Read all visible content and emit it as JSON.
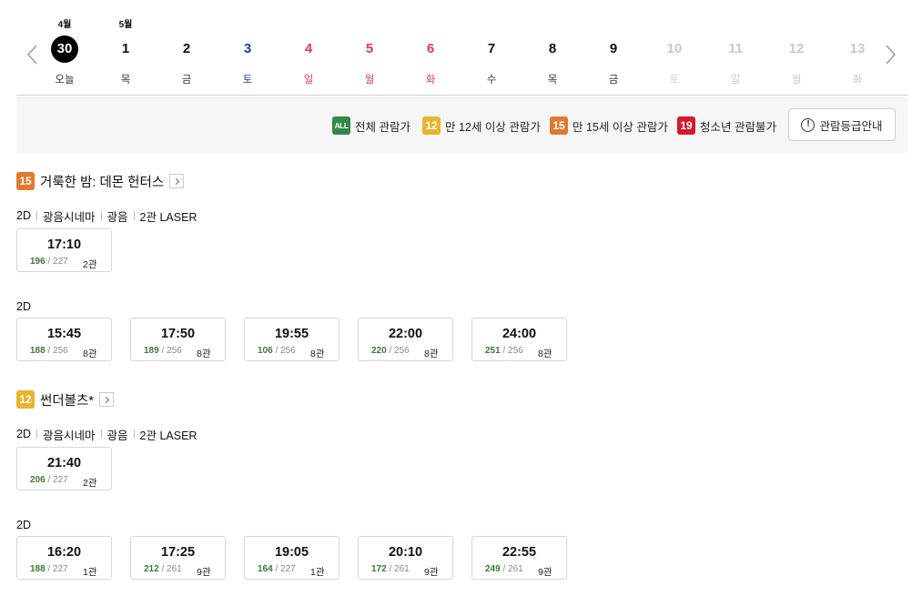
{
  "dates": [
    {
      "month": "4월",
      "day": "30",
      "dow": "오늘",
      "state": "today"
    },
    {
      "month": "5월",
      "day": "1",
      "dow": "목",
      "state": "normal"
    },
    {
      "month": "",
      "day": "2",
      "dow": "금",
      "state": "normal"
    },
    {
      "month": "",
      "day": "3",
      "dow": "토",
      "state": "sat"
    },
    {
      "month": "",
      "day": "4",
      "dow": "일",
      "state": "sun"
    },
    {
      "month": "",
      "day": "5",
      "dow": "월",
      "state": "sun"
    },
    {
      "month": "",
      "day": "6",
      "dow": "화",
      "state": "sun"
    },
    {
      "month": "",
      "day": "7",
      "dow": "수",
      "state": "normal"
    },
    {
      "month": "",
      "day": "8",
      "dow": "목",
      "state": "normal"
    },
    {
      "month": "",
      "day": "9",
      "dow": "금",
      "state": "normal"
    },
    {
      "month": "",
      "day": "10",
      "dow": "토",
      "state": "dis"
    },
    {
      "month": "",
      "day": "11",
      "dow": "일",
      "state": "dis"
    },
    {
      "month": "",
      "day": "12",
      "dow": "월",
      "state": "dis"
    },
    {
      "month": "",
      "day": "13",
      "dow": "화",
      "state": "dis"
    }
  ],
  "legend": {
    "all": {
      "badge": "ALL",
      "label": "전체 관람가"
    },
    "r12": {
      "badge": "12",
      "label": "만 12세 이상 관람가"
    },
    "r15": {
      "badge": "15",
      "label": "만 15세 이상 관람가"
    },
    "r19": {
      "badge": "19",
      "label": "청소년 관람불가"
    },
    "guide_label": "관람등급안내",
    "guide_icon": "!"
  },
  "movies": [
    {
      "rating": "15",
      "title": "거룩한 밤: 데몬 헌터스",
      "groups": [
        {
          "format": "2D",
          "tags": [
            "광음시네마",
            "광음",
            "2관 LASER"
          ],
          "slots": [
            {
              "time": "17:10",
              "remain": "196",
              "total": "/ 227",
              "hall": "2관"
            }
          ]
        },
        {
          "format": "2D",
          "tags": [],
          "slots": [
            {
              "time": "15:45",
              "remain": "188",
              "total": "/ 256",
              "hall": "8관"
            },
            {
              "time": "17:50",
              "remain": "189",
              "total": "/ 256",
              "hall": "8관"
            },
            {
              "time": "19:55",
              "remain": "106",
              "total": "/ 256",
              "hall": "8관"
            },
            {
              "time": "22:00",
              "remain": "220",
              "total": "/ 256",
              "hall": "8관"
            },
            {
              "time": "24:00",
              "remain": "251",
              "total": "/ 256",
              "hall": "8관"
            }
          ]
        }
      ]
    },
    {
      "rating": "12",
      "title": "썬더볼츠*",
      "groups": [
        {
          "format": "2D",
          "tags": [
            "광음시네마",
            "광음",
            "2관 LASER"
          ],
          "slots": [
            {
              "time": "21:40",
              "remain": "206",
              "total": "/ 227",
              "hall": "2관"
            }
          ]
        },
        {
          "format": "2D",
          "tags": [],
          "slots": [
            {
              "time": "16:20",
              "remain": "188",
              "total": "/ 227",
              "hall": "1관"
            },
            {
              "time": "17:25",
              "remain": "212",
              "total": "/ 261",
              "hall": "9관"
            },
            {
              "time": "19:05",
              "remain": "164",
              "total": "/ 227",
              "hall": "1관"
            },
            {
              "time": "20:10",
              "remain": "172",
              "total": "/ 261",
              "hall": "9관"
            },
            {
              "time": "22:55",
              "remain": "249",
              "total": "/ 261",
              "hall": "9관"
            }
          ]
        }
      ]
    }
  ],
  "icons": {
    "prev": "chevron-left-icon",
    "next": "chevron-right-icon",
    "more": "chevron-right-small-icon"
  }
}
